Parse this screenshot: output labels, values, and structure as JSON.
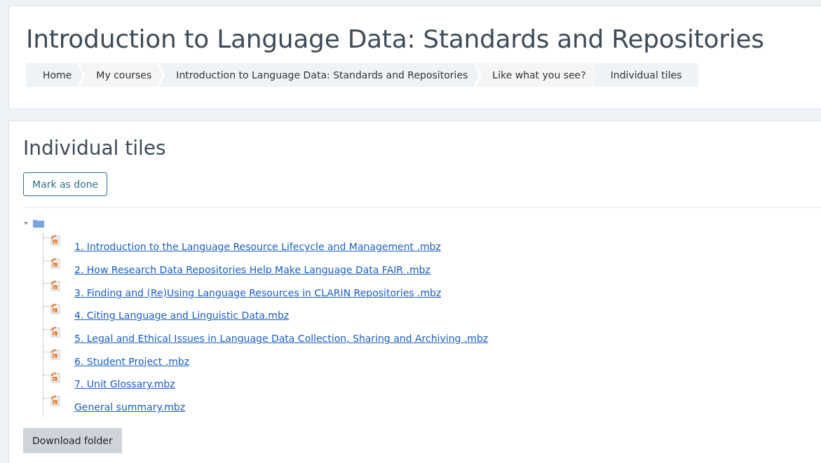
{
  "header": {
    "title": "Introduction to Language Data: Standards and Repositories",
    "breadcrumbs": [
      "Home",
      "My courses",
      "Introduction to Language Data: Standards and Repositories",
      "Like what you see?",
      "Individual tiles"
    ]
  },
  "main": {
    "heading": "Individual tiles",
    "mark_button": "Mark as done",
    "folder": {
      "expanded": true,
      "files": [
        "1. Introduction to the Language Resource Lifecycle and Management .mbz",
        "2. How Research Data Repositories Help Make Language Data FAIR .mbz",
        "3. Finding and (Re)Using Language Resources in CLARIN Repositories .mbz",
        "4. Citing Language and Linguistic Data.mbz",
        "5. Legal and Ethical Issues in Language Data Collection, Sharing and Archiving .mbz",
        "6. Student Project .mbz",
        "7. Unit Glossary.mbz",
        "General summary.mbz"
      ]
    },
    "download_button": "Download folder"
  }
}
